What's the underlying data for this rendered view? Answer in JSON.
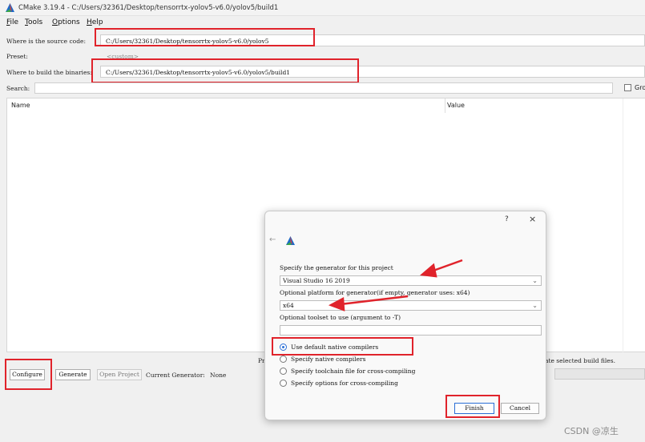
{
  "window": {
    "title": "CMake 3.19.4 - C:/Users/32361/Desktop/tensorrtx-yolov5-v6.0/yolov5/build1"
  },
  "menu": [
    {
      "label": "File",
      "mnemonic": "F",
      "rest": "ile"
    },
    {
      "label": "Tools",
      "mnemonic": "T",
      "rest": "ools"
    },
    {
      "label": "Options",
      "mnemonic": "O",
      "rest": "ptions"
    },
    {
      "label": "Help",
      "mnemonic": "H",
      "rest": "elp"
    }
  ],
  "source": {
    "label": "Where is the source code:",
    "value": "C:/Users/32361/Desktop/tensorrtx-yolov5-v6.0/yolov5"
  },
  "preset": {
    "label": "Preset:",
    "value": "<custom>"
  },
  "binaries": {
    "label": "Where to build the binaries:",
    "value": "C:/Users/32361/Desktop/tensorrtx-yolov5-v6.0/yolov5/build1"
  },
  "search": {
    "label": "Search:",
    "value": "",
    "grouped_label": "Gro"
  },
  "table": {
    "col_name": "Name",
    "col_value": "Value"
  },
  "status": {
    "left_text": "Pr",
    "right_text": "ate selected build files."
  },
  "bottom": {
    "configure": "Configure",
    "generate": "Generate",
    "open_project": "Open Project",
    "current_generator_label": "Current Generator:",
    "current_generator_value": "None"
  },
  "dialog": {
    "help": "?",
    "close": "×",
    "back": "←",
    "generator_label": "Specify the generator for this project",
    "generator_value": "Visual Studio 16 2019",
    "platform_label": "Optional platform for generator(if empty, generator uses: x64)",
    "platform_value": "x64",
    "toolset_label": "Optional toolset to use (argument to -T)",
    "toolset_value": "",
    "options": [
      {
        "label": "Use default native compilers",
        "selected": true
      },
      {
        "label": "Specify native compilers",
        "selected": false
      },
      {
        "label": "Specify toolchain file for cross-compiling",
        "selected": false
      },
      {
        "label": "Specify options for cross-compiling",
        "selected": false
      }
    ],
    "finish": "Finish",
    "cancel": "Cancel"
  },
  "watermark": "CSDN @凉生",
  "colors": {
    "highlight": "#e0232b",
    "accent": "#2b6fd6"
  }
}
